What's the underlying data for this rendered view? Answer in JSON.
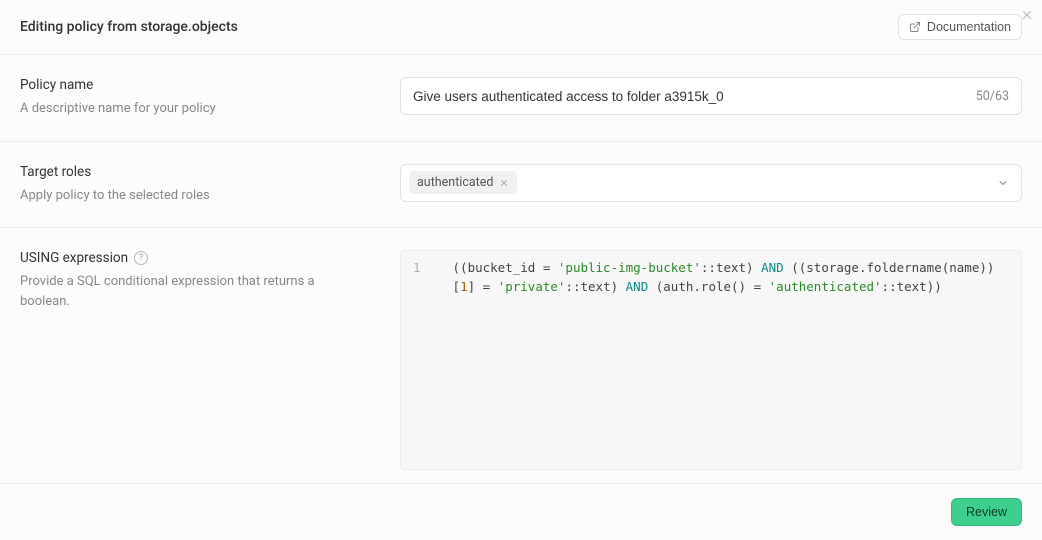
{
  "header": {
    "title": "Editing policy from storage.objects",
    "documentation_label": "Documentation"
  },
  "policy_name": {
    "label": "Policy name",
    "description": "A descriptive name for your policy",
    "value": "Give users authenticated access to folder a3915k_0",
    "char_count": "50/63"
  },
  "target_roles": {
    "label": "Target roles",
    "description": "Apply policy to the selected roles",
    "chips": [
      "authenticated"
    ]
  },
  "using_expression": {
    "label": "USING expression",
    "description": "Provide a SQL conditional expression that returns a boolean.",
    "line_numbers": [
      "1"
    ],
    "code_tokens": [
      {
        "t": "((bucket_id = ",
        "c": "punc"
      },
      {
        "t": "'public-img-bucket'",
        "c": "str"
      },
      {
        "t": "::text",
        "c": "punc"
      },
      {
        "t": ") ",
        "c": "punc"
      },
      {
        "t": "AND",
        "c": "kw"
      },
      {
        "t": " ((storage.foldername(name))[",
        "c": "punc"
      },
      {
        "t": "1",
        "c": "num"
      },
      {
        "t": "] = ",
        "c": "punc"
      },
      {
        "t": "'private'",
        "c": "str"
      },
      {
        "t": "::text",
        "c": "punc"
      },
      {
        "t": ") ",
        "c": "punc"
      },
      {
        "t": "AND",
        "c": "kw"
      },
      {
        "t": " (auth.role() = ",
        "c": "punc"
      },
      {
        "t": "'authenticated'",
        "c": "str"
      },
      {
        "t": "::text",
        "c": "punc"
      },
      {
        "t": "))",
        "c": "punc"
      }
    ]
  },
  "footer": {
    "review_label": "Review"
  }
}
